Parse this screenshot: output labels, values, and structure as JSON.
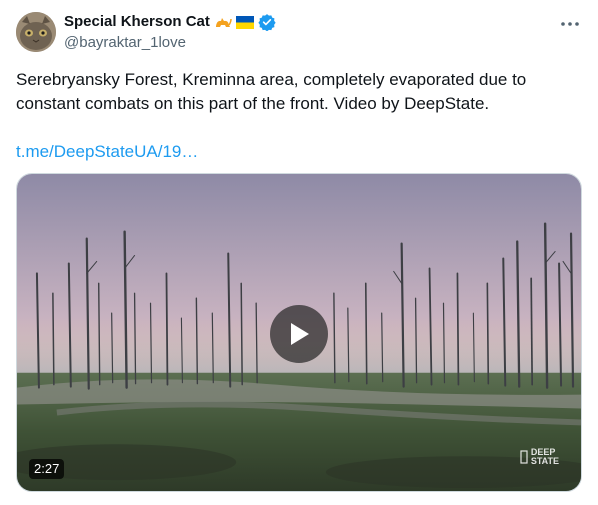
{
  "author": {
    "display_name": "Special Kherson Cat",
    "handle": "@bayraktar_1love",
    "verified": true
  },
  "icons": {
    "more": "more-options-icon",
    "verified": "verified-badge-icon",
    "cat": "cat-emoji-icon",
    "flag": "ukraine-flag-icon",
    "play": "play-icon"
  },
  "tweet": {
    "text": "Serebryansky Forest, Kreminna area, completely evaporated due to\nconstant combats on this part of the front. Video by DeepState.",
    "link": "t.me/DeepStateUA/19…"
  },
  "media": {
    "duration": "2:27",
    "watermark_line1": "DEEP",
    "watermark_line2": "STATE"
  },
  "colors": {
    "link": "#1d9bf0",
    "verified": "#1d9bf0",
    "flag_blue": "#0057b7",
    "flag_yellow": "#ffd700"
  }
}
